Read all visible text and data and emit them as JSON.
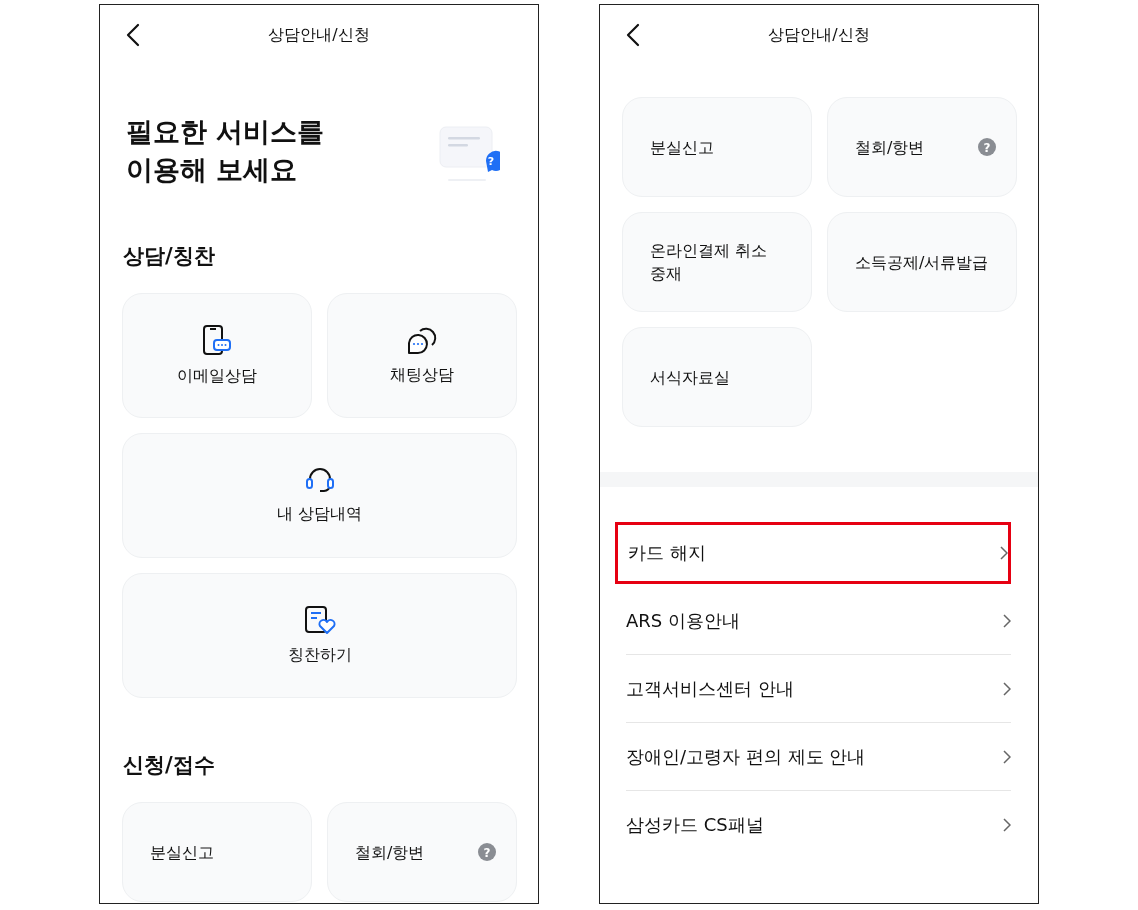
{
  "screens": [
    {
      "header": {
        "title": "상담안내/신청"
      },
      "hero": {
        "lines": [
          "필요한 서비스를",
          "이용해 보세요"
        ],
        "badge": "?"
      },
      "sections": [
        {
          "title": "상담/칭찬",
          "cards": [
            {
              "kind": "icon",
              "label": "이메일상담",
              "wide": false
            },
            {
              "kind": "icon",
              "label": "채팅상담",
              "wide": false
            },
            {
              "kind": "icon",
              "label": "내 상담내역",
              "wide": true
            },
            {
              "kind": "icon",
              "label": "칭찬하기",
              "wide": true
            }
          ]
        },
        {
          "title": "신청/접수",
          "cards": [
            {
              "kind": "text",
              "label": "분실신고"
            },
            {
              "kind": "text",
              "label": "철회/항변",
              "help": "?"
            }
          ]
        }
      ]
    },
    {
      "header": {
        "title": "상담안내/신청"
      },
      "sections": [
        {
          "cards": [
            {
              "kind": "text",
              "label": "분실신고"
            },
            {
              "kind": "text",
              "label": "철회/항변",
              "help": "?"
            },
            {
              "kind": "text",
              "label": "온라인결제 취소\n중재"
            },
            {
              "kind": "text",
              "label": "소득공제/서류발급"
            },
            {
              "kind": "text",
              "label": "서식자료실"
            }
          ]
        }
      ],
      "links": [
        {
          "label": "카드 해지",
          "highlighted": true
        },
        {
          "label": "ARS 이용안내",
          "highlighted": false
        },
        {
          "label": "고객서비스센터 안내",
          "highlighted": false
        },
        {
          "label": "장애인/고령자 편의 제도 안내",
          "highlighted": false
        },
        {
          "label": "삼성카드 CS패널",
          "highlighted": false
        }
      ]
    }
  ]
}
